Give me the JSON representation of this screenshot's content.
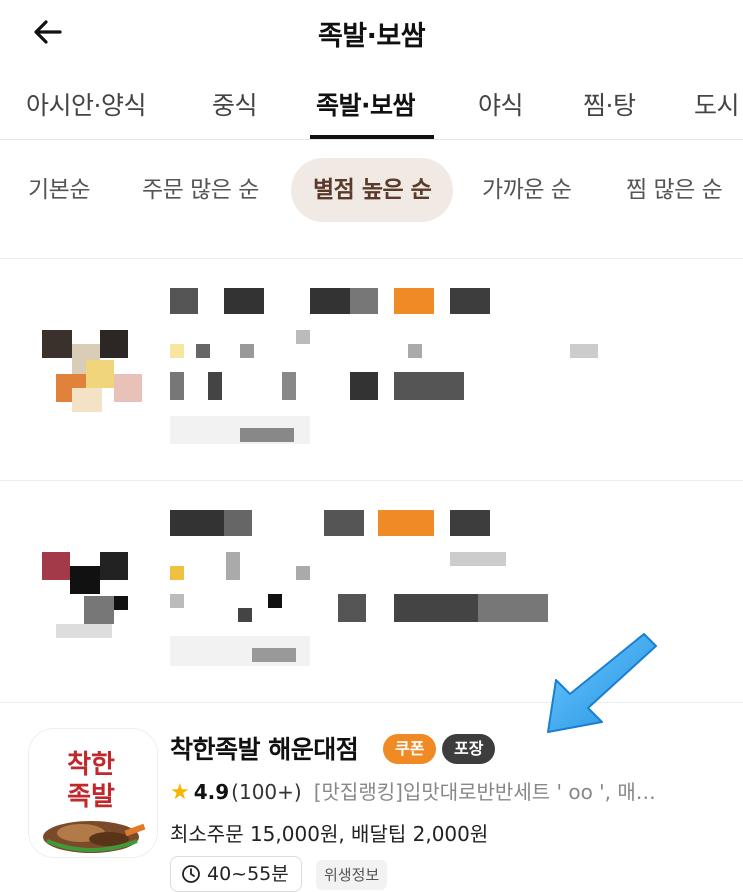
{
  "header": {
    "title": "족발·보쌈",
    "back_icon": "arrow-left-icon"
  },
  "category_tabs": [
    {
      "label": "아시안·양식",
      "active": false
    },
    {
      "label": "중식",
      "active": false
    },
    {
      "label": "족발·보쌈",
      "active": true
    },
    {
      "label": "야식",
      "active": false
    },
    {
      "label": "찜·탕",
      "active": false
    },
    {
      "label": "도시",
      "active": false
    }
  ],
  "sort_options": [
    {
      "label": "기본순",
      "active": false
    },
    {
      "label": "주문 많은 순",
      "active": false
    },
    {
      "label": "별점 높은 순",
      "active": true
    },
    {
      "label": "가까운 순",
      "active": false
    },
    {
      "label": "찜 많은 순",
      "active": false
    }
  ],
  "store": {
    "name": "착한족발 해운대점",
    "coupon_badge": "쿠폰",
    "pickup_badge": "포장",
    "rating": "4.9",
    "review_count": "(100+)",
    "menu_desc": "[맛집랭킹]입맛대로반반세트 ' oo ', 매…",
    "fees": "최소주문 15,000원, 배달팁 2,000원",
    "delivery_time": "40~55분",
    "hygiene_label": "위생정보",
    "logo_text": "착한족발"
  },
  "colors": {
    "accent_orange": "#f08a24",
    "dark_badge": "#3d3d3d",
    "sort_active_bg": "#f1e9e3",
    "arrow_blue": "#2ea4f0",
    "star": "#f7b500"
  }
}
